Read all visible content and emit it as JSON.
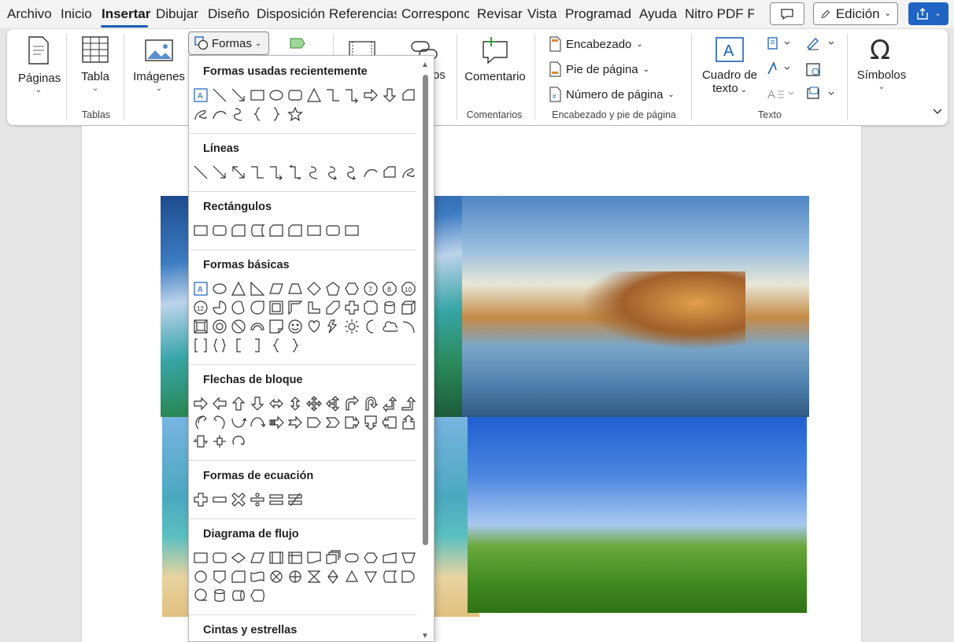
{
  "menu": {
    "tabs": [
      "Archivo",
      "Inicio",
      "Insertar",
      "Dibujar",
      "Diseño",
      "Disposición",
      "Referencias",
      "Corresponc",
      "Revisar",
      "Vista",
      "Programad",
      "Ayuda",
      "Nitro PDF F"
    ],
    "edit_mode": "Edición"
  },
  "ribbon": {
    "paginas": "Páginas",
    "tabla": "Tabla",
    "imagenes": "Imágenes",
    "formas": "Formas",
    "vinculos_partial": "os",
    "comentario": "Comentario",
    "encabezado": "Encabezado",
    "pie": "Pie de página",
    "numero": "Número de página",
    "cuadro1": "Cuadro de",
    "cuadro2": "texto",
    "simbolos": "Símbolos",
    "groups": {
      "tablas": "Tablas",
      "comentarios": "Comentarios",
      "encabezado_pie": "Encabezado y pie de página",
      "texto": "Texto"
    }
  },
  "shapes_menu": {
    "recientes": "Formas usadas recientemente",
    "lineas": "Líneas",
    "rectangulos": "Rectángulos",
    "basicas": "Formas básicas",
    "flechas": "Flechas de bloque",
    "ecuacion": "Formas de ecuación",
    "flujo": "Diagrama de flujo",
    "cintas": "Cintas y estrellas"
  },
  "colors": {
    "accent": "#1b5fb4",
    "share": "#1f64c2"
  }
}
